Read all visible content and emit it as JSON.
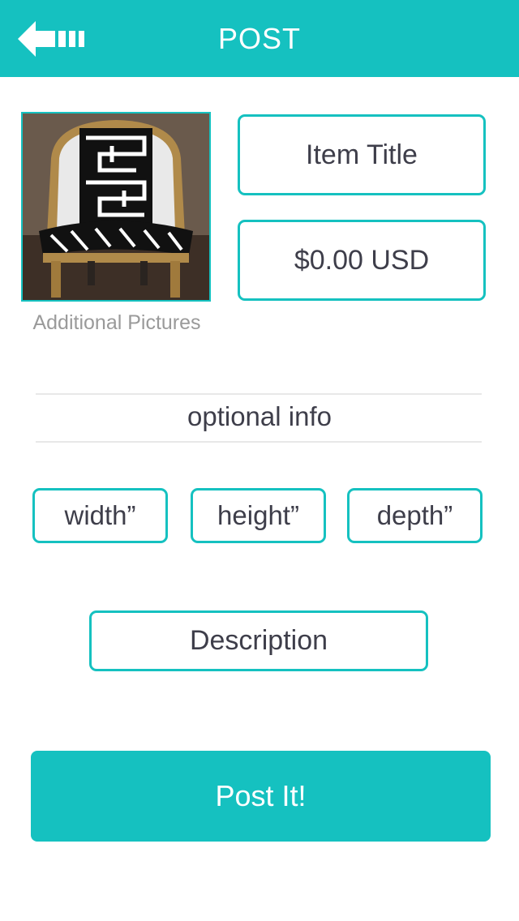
{
  "header": {
    "title": "POST",
    "back_icon": "back-arrow-icon",
    "background": "#15c1c0"
  },
  "item": {
    "photo_alt": "chair-photo",
    "additional_pictures_label": "Additional Pictures",
    "title_placeholder": "Item Title",
    "price_placeholder": "$0.00 USD"
  },
  "optional": {
    "heading": "optional info",
    "width_placeholder": "width”",
    "height_placeholder": "height”",
    "depth_placeholder": "depth”",
    "description_placeholder": "Description"
  },
  "actions": {
    "post_label": "Post It!"
  },
  "colors": {
    "accent": "#15c1c0",
    "text": "#3e3e4a",
    "muted": "#9a9a9a"
  }
}
